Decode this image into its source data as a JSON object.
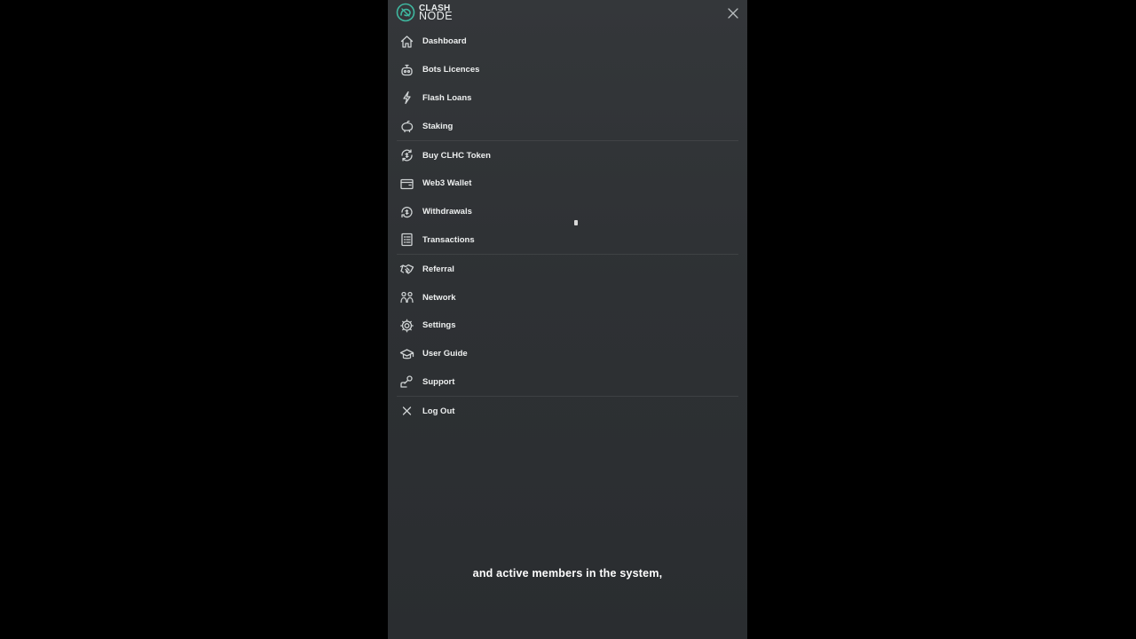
{
  "brand": {
    "line1": "CLASH",
    "line2": "NODE",
    "accent_color": "#3fb8a0"
  },
  "menu": {
    "groups": [
      [
        {
          "label": "Dashboard",
          "icon": "home-icon"
        },
        {
          "label": "Bots Licences",
          "icon": "robot-icon"
        },
        {
          "label": "Flash Loans",
          "icon": "lightning-icon"
        },
        {
          "label": "Staking",
          "icon": "piggy-bank-icon"
        }
      ],
      [
        {
          "label": "Buy CLHC Token",
          "icon": "coin-exchange-icon"
        },
        {
          "label": "Web3 Wallet",
          "icon": "wallet-icon"
        },
        {
          "label": "Withdrawals",
          "icon": "withdraw-icon"
        },
        {
          "label": "Transactions",
          "icon": "list-icon"
        }
      ],
      [
        {
          "label": "Referral",
          "icon": "handshake-icon"
        },
        {
          "label": "Network",
          "icon": "network-icon"
        },
        {
          "label": "Settings",
          "icon": "gear-icon"
        },
        {
          "label": "User Guide",
          "icon": "graduation-cap-icon"
        },
        {
          "label": "Support",
          "icon": "support-icon"
        }
      ],
      [
        {
          "label": "Log Out",
          "icon": "close-icon"
        }
      ]
    ]
  },
  "caption": "and active members in the system,"
}
